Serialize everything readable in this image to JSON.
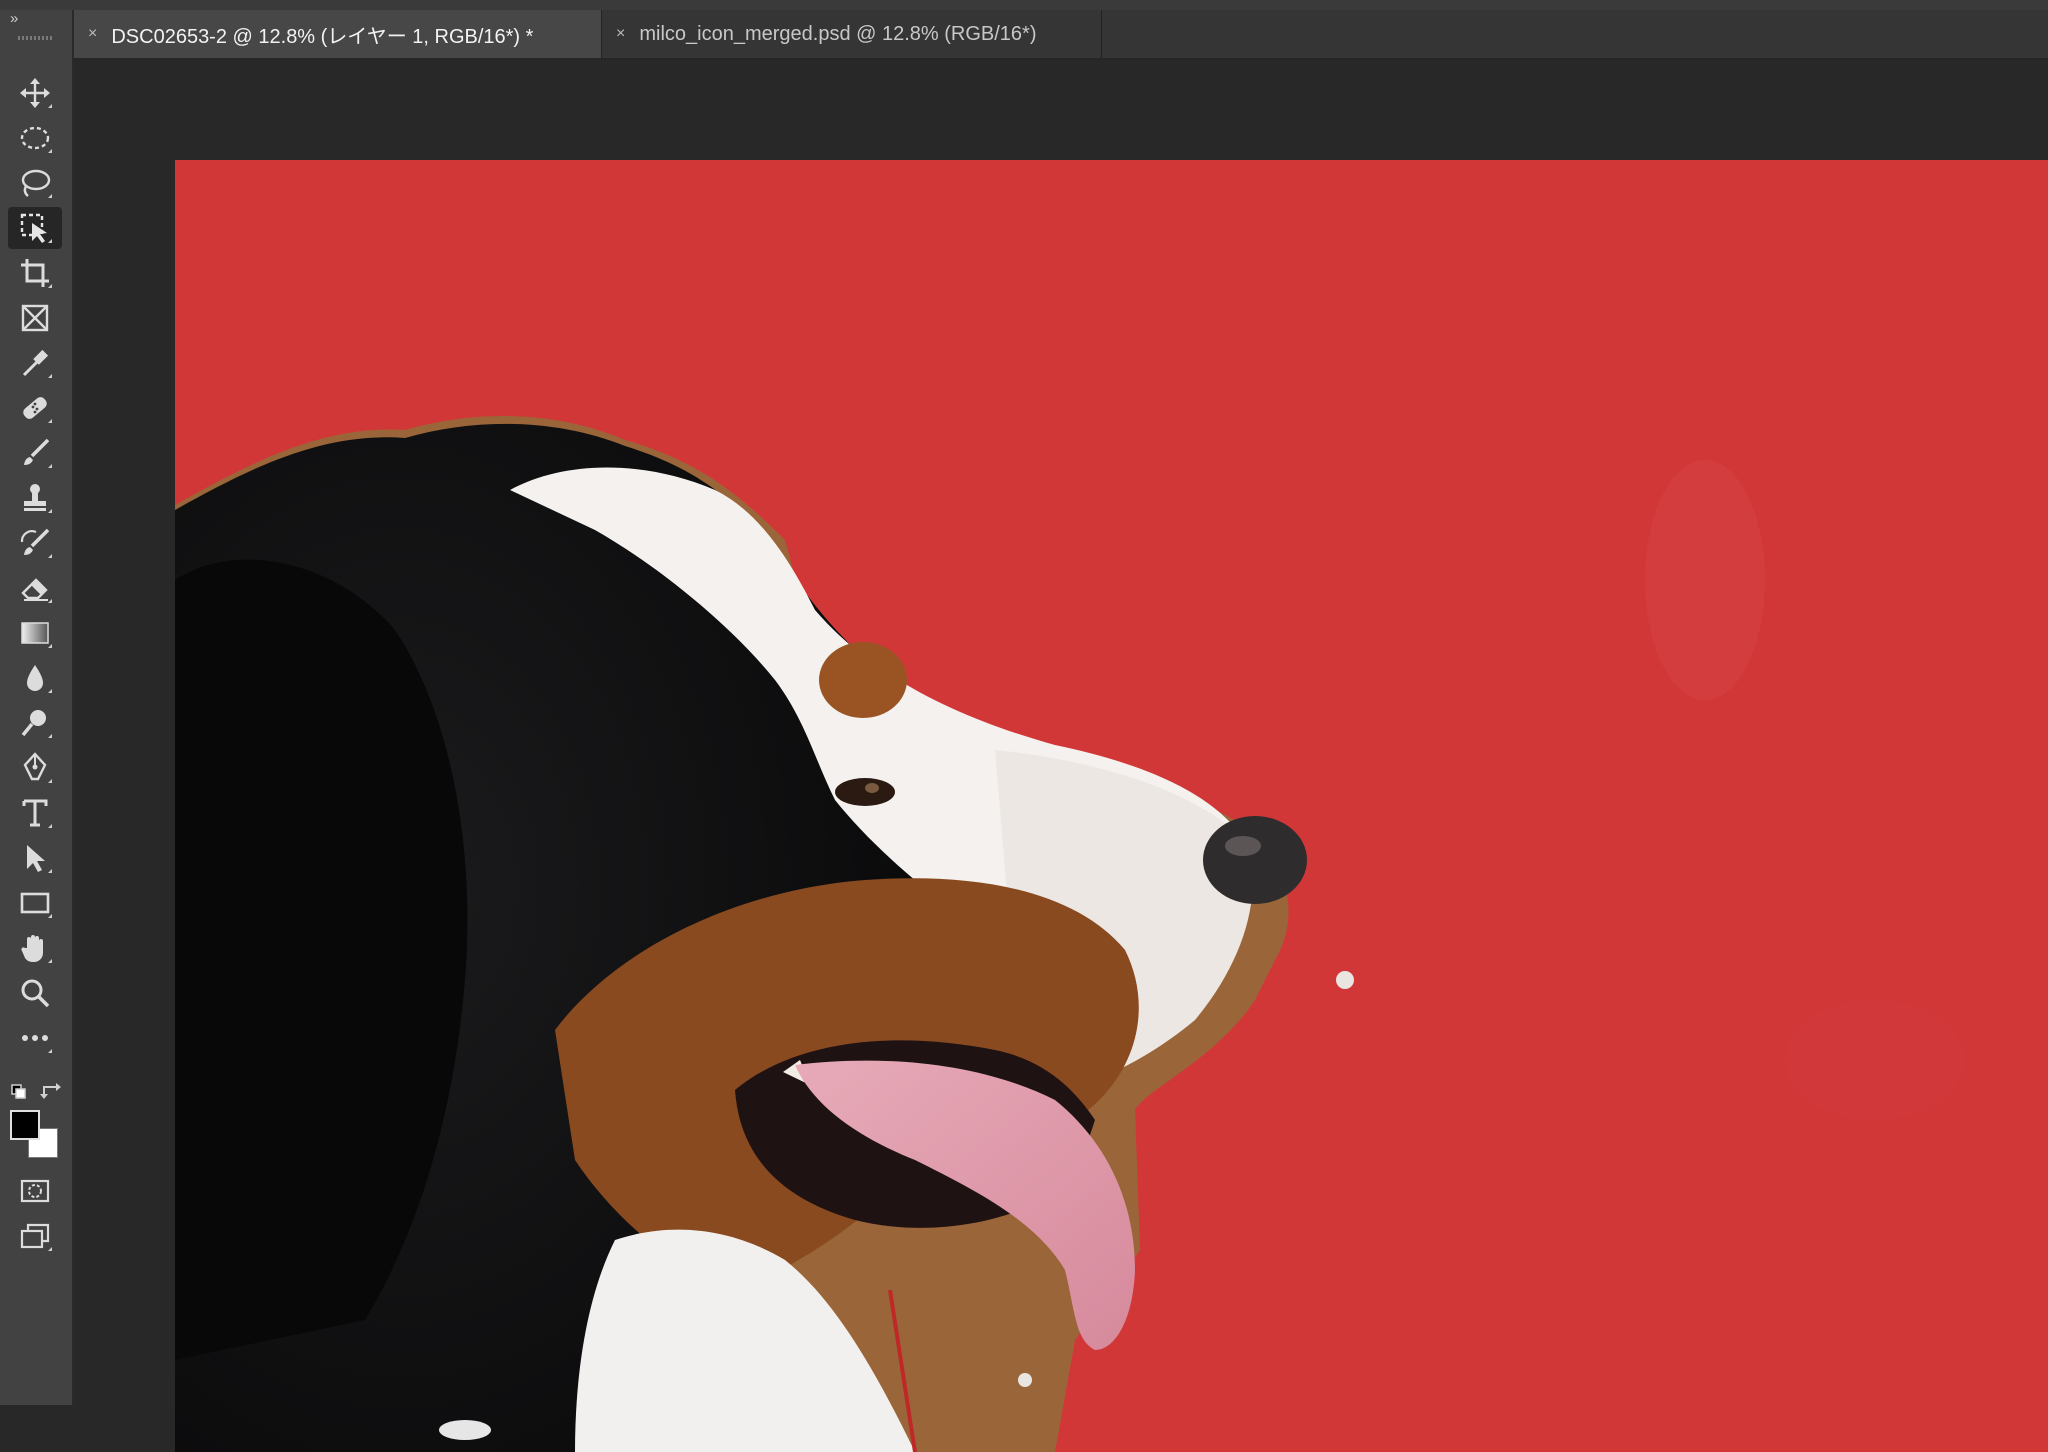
{
  "app": {
    "collapse_glyph": "»"
  },
  "tabs": [
    {
      "label": "DSC02653-2 @ 12.8% (レイヤー 1, RGB/16*) *",
      "close": "×",
      "active": true
    },
    {
      "label": "milco_icon_merged.psd @ 12.8% (RGB/16*)",
      "close": "×",
      "active": false
    }
  ],
  "tools": [
    {
      "icon": "move-icon"
    },
    {
      "icon": "elliptical-marquee-icon"
    },
    {
      "icon": "lasso-icon"
    },
    {
      "icon": "object-selection-icon",
      "active": true
    },
    {
      "icon": "crop-icon"
    },
    {
      "icon": "frame-icon"
    },
    {
      "icon": "eyedropper-icon"
    },
    {
      "icon": "healing-brush-icon"
    },
    {
      "icon": "brush-icon"
    },
    {
      "icon": "clone-stamp-icon"
    },
    {
      "icon": "history-brush-icon"
    },
    {
      "icon": "eraser-icon"
    },
    {
      "icon": "gradient-icon"
    },
    {
      "icon": "blur-icon"
    },
    {
      "icon": "dodge-icon"
    },
    {
      "icon": "pen-icon"
    },
    {
      "icon": "type-icon"
    },
    {
      "icon": "path-selection-icon"
    },
    {
      "icon": "rectangle-icon"
    },
    {
      "icon": "hand-icon"
    },
    {
      "icon": "zoom-icon"
    },
    {
      "icon": "more-tools-icon"
    }
  ],
  "colors": {
    "foreground": "#000000",
    "background": "#ffffff",
    "canvas_fill": "#d23738"
  }
}
